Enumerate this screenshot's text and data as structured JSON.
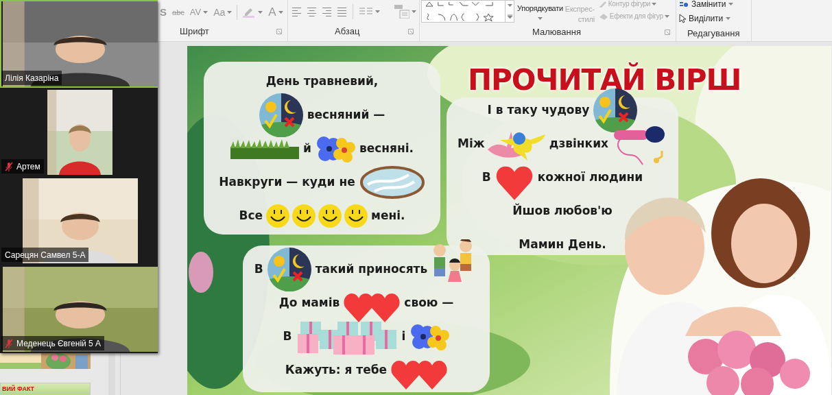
{
  "ribbon": {
    "font_group": {
      "label": "Шрифт",
      "tools": [
        {
          "kind": "shadow",
          "text": "S"
        },
        {
          "kind": "strike",
          "text": "abc"
        },
        {
          "kind": "spacing",
          "text": "AV"
        },
        {
          "kind": "case",
          "text": "Aa"
        },
        {
          "kind": "highlight"
        },
        {
          "kind": "color",
          "text": "A"
        }
      ]
    },
    "paragraph_group": {
      "label": "Абзац"
    },
    "drawing_group": {
      "label": "Малювання",
      "buttons": [
        {
          "kind": "arrange",
          "lines": [
            "Упорядкувати"
          ],
          "disabled": false
        },
        {
          "kind": "quick-styles",
          "lines": [
            "Експрес-",
            "стилі"
          ],
          "disabled": true
        },
        {
          "kind": "outline",
          "lines": [
            "Контур фігури"
          ],
          "disabled": true
        },
        {
          "kind": "effects",
          "lines": [
            "Ефекти для фігур"
          ],
          "disabled": true
        }
      ]
    },
    "editing_group": {
      "label": "Редагування",
      "buttons": [
        {
          "kind": "replace",
          "label": "Замінити",
          "disabled": false
        },
        {
          "kind": "select",
          "label": "Виділити",
          "disabled": false
        }
      ]
    }
  },
  "thumbnails": [
    {
      "kind": "picture"
    },
    {
      "kind": "title",
      "text": "ВИЙ ФАКТ"
    }
  ],
  "participants": [
    {
      "name": "Лілія Казаріна",
      "muted": false,
      "highlighted": true
    },
    {
      "name": "Артем",
      "muted": true,
      "highlighted": false
    },
    {
      "name": "Сарецян Самвел 5-А",
      "muted": false,
      "highlighted": false
    },
    {
      "name": "Меденець Євгеній 5 А",
      "muted": true,
      "highlighted": false
    }
  ],
  "slide": {
    "title": "ПРОЧИТАЙ ВІРШ",
    "cards": [
      {
        "lines": [
          [
            {
              "kind": "text",
              "text": "День травневий,"
            }
          ],
          [
            {
              "kind": "sun-moon"
            },
            {
              "kind": "text",
              "text": "весняний —"
            }
          ],
          [
            {
              "kind": "grass"
            },
            {
              "kind": "text",
              "text": "й"
            },
            {
              "kind": "flowers"
            },
            {
              "kind": "text",
              "text": "весняні."
            }
          ],
          [
            {
              "kind": "text",
              "text": "Навкруги — куди не"
            },
            {
              "kind": "mirror"
            }
          ],
          [
            {
              "kind": "text",
              "text": "Все"
            },
            {
              "kind": "smiley"
            },
            {
              "kind": "smiley"
            },
            {
              "kind": "smiley"
            },
            {
              "kind": "smiley"
            },
            {
              "kind": "text",
              "text": "мені."
            }
          ]
        ]
      },
      {
        "lines": [
          [
            {
              "kind": "text",
              "text": "І в таку чудову"
            },
            {
              "kind": "sun-moon"
            }
          ],
          [
            {
              "kind": "text",
              "text": "Між"
            },
            {
              "kind": "birds"
            },
            {
              "kind": "text",
              "text": "дзвінких"
            },
            {
              "kind": "microphone"
            }
          ],
          [
            {
              "kind": "text",
              "text": "В"
            },
            {
              "kind": "heart"
            },
            {
              "kind": "text",
              "text": "кожної людини"
            }
          ],
          [
            {
              "kind": "text",
              "text": "Йшов любов'ю"
            }
          ],
          [
            {
              "kind": "text",
              "text": "Мамин День."
            }
          ]
        ]
      },
      {
        "lines": [
          [
            {
              "kind": "text",
              "text": "В"
            },
            {
              "kind": "sun-moon"
            },
            {
              "kind": "text",
              "text": "такий приносять"
            },
            {
              "kind": "children"
            }
          ],
          [
            {
              "kind": "text",
              "text": "До мамів"
            },
            {
              "kind": "hearts"
            },
            {
              "kind": "text",
              "text": "свою —"
            }
          ],
          [
            {
              "kind": "text",
              "text": "В"
            },
            {
              "kind": "gifts"
            },
            {
              "kind": "text",
              "text": "і"
            },
            {
              "kind": "flowers"
            }
          ],
          [
            {
              "kind": "text",
              "text": "Кажуть: я тебе"
            },
            {
              "kind": "hearts"
            }
          ]
        ]
      }
    ]
  }
}
